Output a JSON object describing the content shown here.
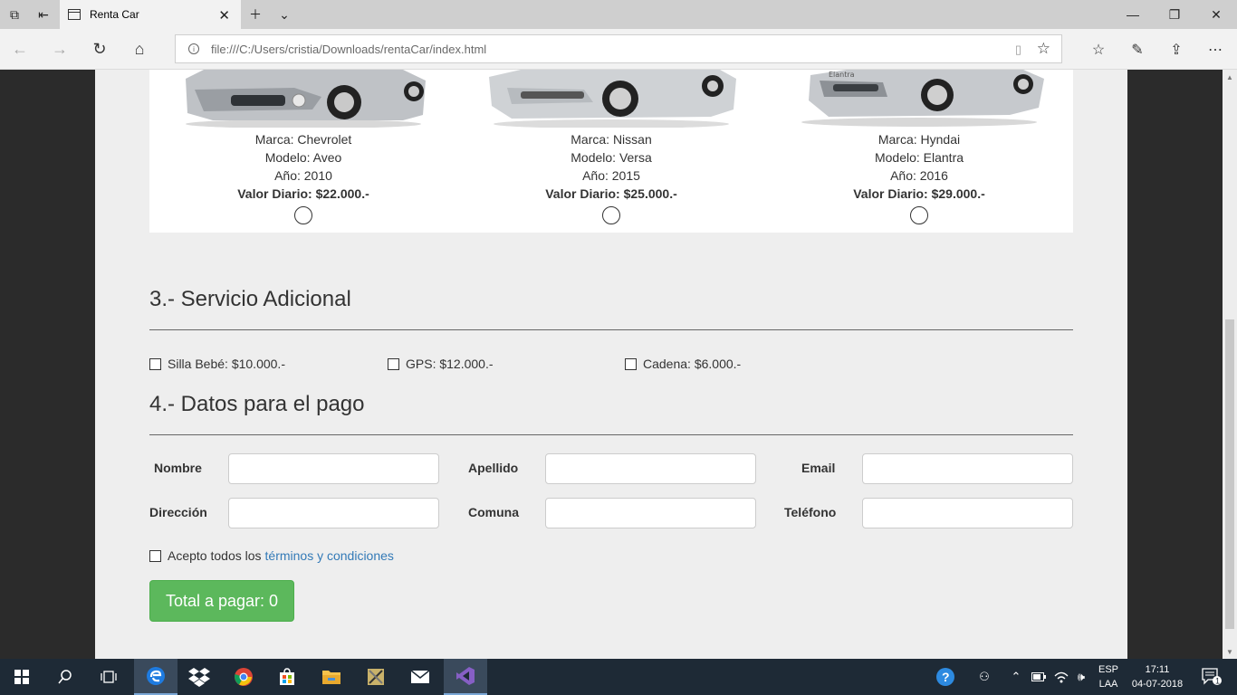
{
  "browser": {
    "tab_title": "Renta Car",
    "url": "file:///C:/Users/cristia/Downloads/rentaCar/index.html"
  },
  "cars": [
    {
      "brand": "Marca: Chevrolet",
      "model": "Modelo: Aveo",
      "year": "Año: 2010",
      "price": "Valor Diario: $22.000.-"
    },
    {
      "brand": "Marca: Nissan",
      "model": "Modelo: Versa",
      "year": "Año: 2015",
      "price": "Valor Diario: $25.000.-"
    },
    {
      "brand": "Marca: Hyndai",
      "model": "Modelo: Elantra",
      "year": "Año: 2016",
      "price": "Valor Diario: $29.000.-",
      "badge": "Elantra"
    }
  ],
  "services": {
    "heading": "3.- Servicio Adicional",
    "items": [
      "Silla Bebé: $10.000.-",
      "GPS: $12.000.-",
      "Cadena: $6.000.-"
    ]
  },
  "payment": {
    "heading": "4.- Datos para el pago",
    "fields": {
      "nombre": "Nombre",
      "apellido": "Apellido",
      "email": "Email",
      "direccion": "Dirección",
      "comuna": "Comuna",
      "telefono": "Teléfono"
    },
    "terms_prefix": "Acepto todos los",
    "terms_link": "términos y condiciones",
    "total_button": "Total a pagar: 0"
  },
  "taskbar": {
    "lang_top": "ESP",
    "lang_bottom": "LAA",
    "time": "17:11",
    "date": "04-07-2018",
    "notifications": "1"
  },
  "colors": {
    "link": "#337ab7",
    "success": "#5cb85c",
    "panel_bg": "#eeeeee"
  }
}
